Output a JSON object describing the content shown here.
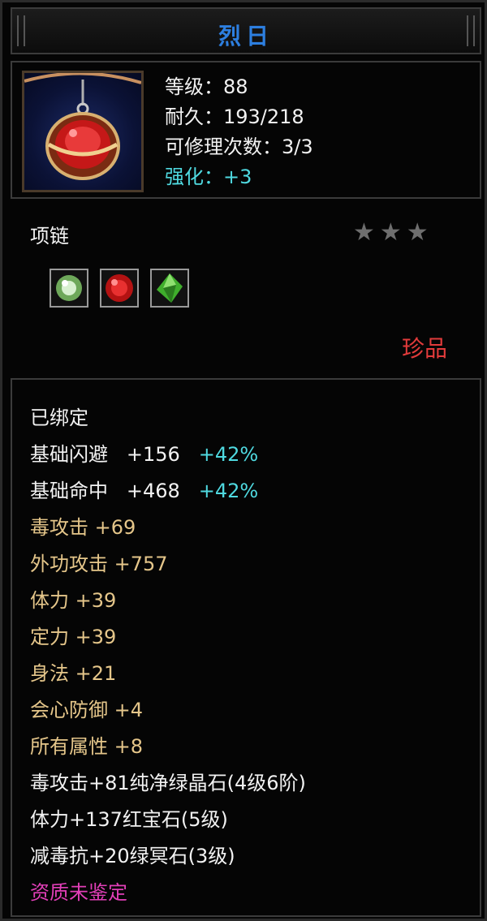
{
  "item": {
    "name": "烈日",
    "category": "项链",
    "rarity": "珍品",
    "stars": "★★★"
  },
  "stats": {
    "level": "等级：88",
    "durability": "耐久：193/218",
    "repairs": "可修理次数：3/3",
    "enhance": "强化：+3"
  },
  "gems": [
    "green-gem-icon",
    "red-gem-icon",
    "green-crystal-icon"
  ],
  "attributes": {
    "bound": "已绑定",
    "dodge_label": "基础闪避",
    "dodge_value": "+156",
    "dodge_bonus": "+42%",
    "hit_label": "基础命中",
    "hit_value": "+468",
    "hit_bonus": "+42%",
    "lines": [
      "毒攻击  +69",
      "外功攻击  +757",
      "体力  +39",
      "定力  +39",
      "身法  +21",
      "会心防御  +4",
      "所有属性  +8"
    ],
    "gem_lines": [
      "毒攻击+81纯净绿晶石(4级6阶)",
      "体力+137红宝石(5级)",
      "减毒抗+20绿冥石(3级)"
    ],
    "aptitude": "资质未鉴定"
  },
  "colors": {
    "title": "#2d7fe0",
    "enhance": "#4fd9e0",
    "rarity": "#e23b3b",
    "attr": "#e5c68a",
    "aptitude": "#e23fb8"
  }
}
